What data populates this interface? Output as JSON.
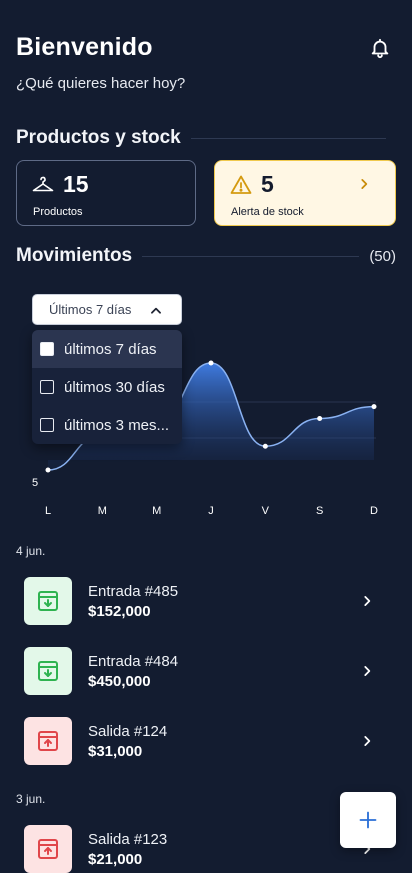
{
  "header": {
    "title": "Bienvenido",
    "subtitle": "¿Qué quieres hacer hoy?",
    "notification_icon": "bell-icon"
  },
  "products_section": {
    "title": "Productos y stock",
    "cards": [
      {
        "icon": "hanger-icon",
        "value": "15",
        "label": "Productos"
      },
      {
        "icon": "warning-icon",
        "value": "5",
        "label": "Alerta de stock",
        "accent": "#f0c94d"
      }
    ]
  },
  "movements": {
    "title": "Movimientos",
    "count": "(50)",
    "filter": {
      "selected": "Últimos 7 días",
      "options": [
        "últimos 7 días",
        "últimos 30 días",
        "últimos 3 mes..."
      ],
      "checked_index": 0
    }
  },
  "chart_data": {
    "type": "area",
    "categories": [
      "L",
      "M",
      "M",
      "J",
      "V",
      "S",
      "D"
    ],
    "values": [
      5,
      14,
      17,
      32,
      11,
      18,
      21
    ],
    "visible_y_tick": "5",
    "color": "#3f7be0"
  },
  "transactions": {
    "groups": [
      {
        "date": "4 jun.",
        "items": [
          {
            "type": "in",
            "name": "Entrada #485",
            "amount": "$152,000"
          },
          {
            "type": "in",
            "name": "Entrada #484",
            "amount": "$450,000"
          },
          {
            "type": "out",
            "name": "Salida #124",
            "amount": "$31,000"
          }
        ]
      },
      {
        "date": "3 jun.",
        "items": [
          {
            "type": "out",
            "name": "Salida #123",
            "amount": "$21,000"
          }
        ]
      }
    ]
  },
  "fab": {
    "icon": "plus-icon"
  },
  "colors": {
    "background": "#131c30",
    "income": "#2fb350",
    "expense": "#e0464a",
    "accent_blue": "#2a6fd6"
  }
}
